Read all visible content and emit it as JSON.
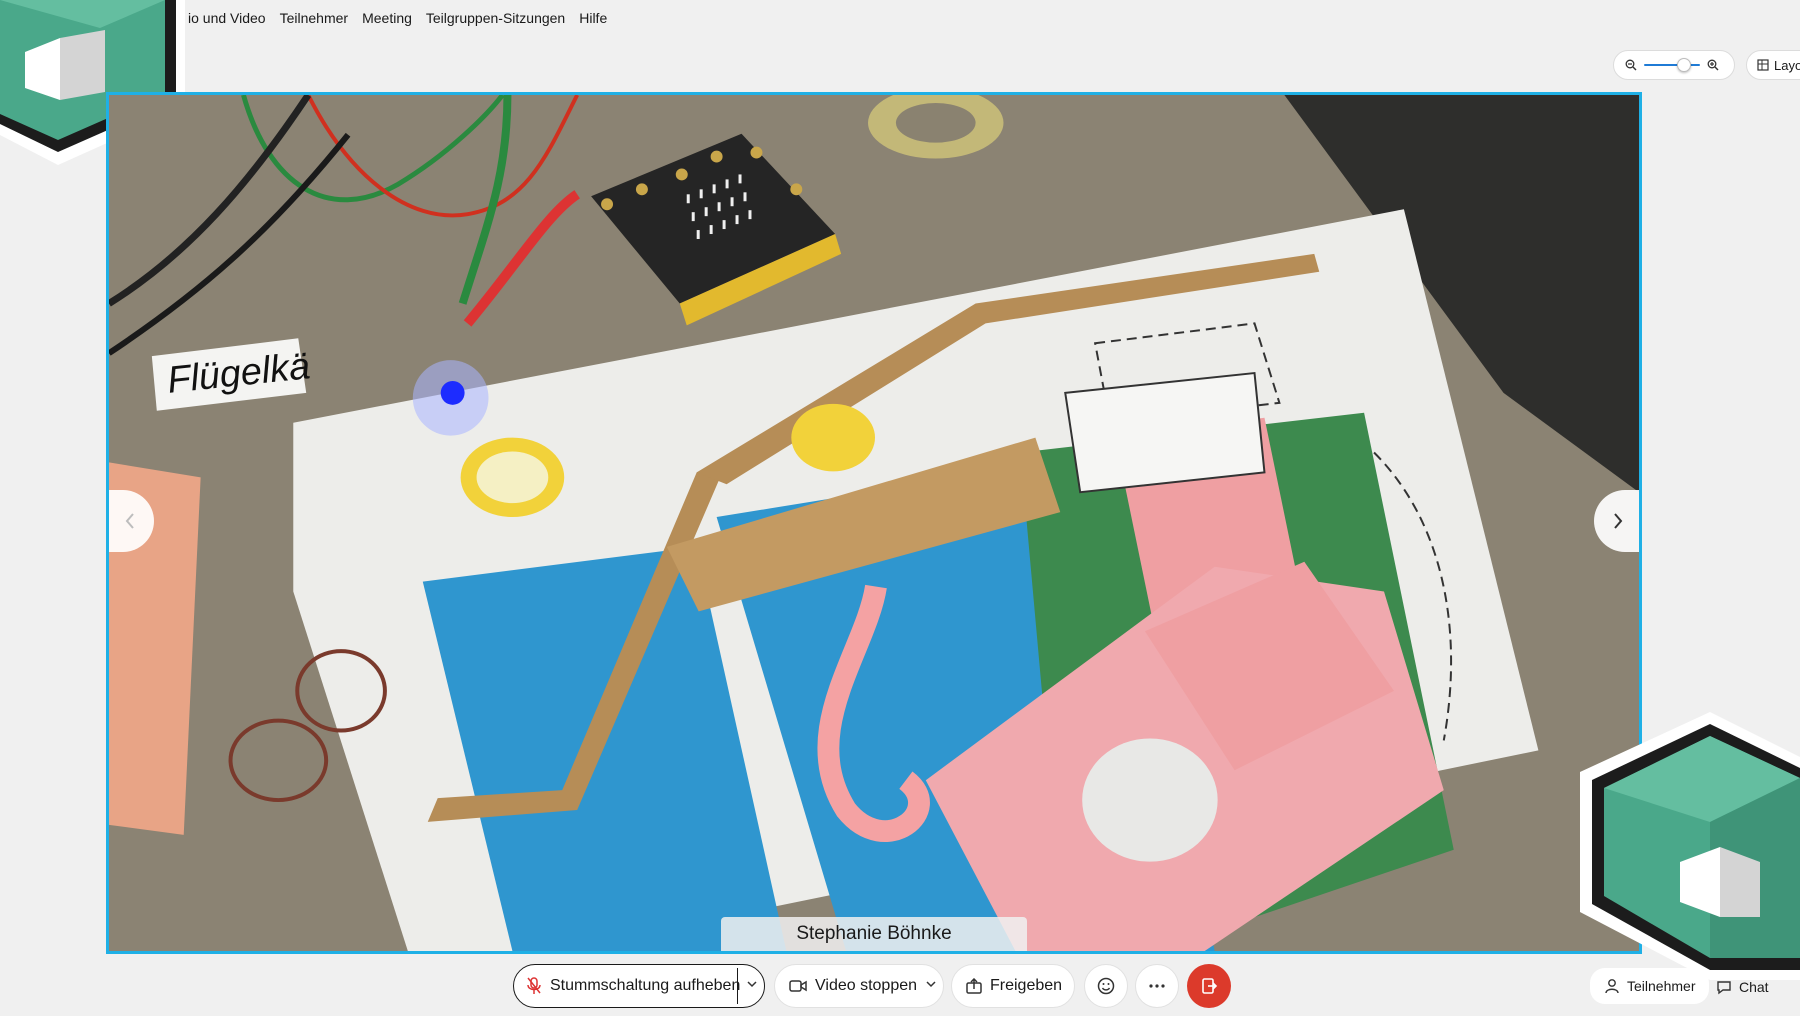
{
  "menu": {
    "items": [
      "io und Video",
      "Teilnehmer",
      "Meeting",
      "Teilgruppen-Sitzungen",
      "Hilfe"
    ]
  },
  "zoom": {
    "level_fraction": 0.78
  },
  "layout_button": {
    "label": "Layo"
  },
  "video": {
    "participant_name": "Stephanie Böhnke",
    "scene_text": "Flügelkä"
  },
  "controls": {
    "mute_label": "Stummschaltung aufheben",
    "video_label": "Video stoppen",
    "share_label": "Freigeben",
    "participants_label": "Teilnehmer",
    "chat_label": "Chat"
  },
  "colors": {
    "active_border": "#1fb0e6",
    "leave_red": "#dc3a2b",
    "hex_green": "#4aa88a",
    "accent_blue": "#1f7bd6"
  },
  "icons": {
    "mic": "microphone-off-icon",
    "camera": "video-camera-icon",
    "share": "share-icon",
    "reactions": "smiley-icon",
    "more": "more-dots-icon",
    "leave": "leave-door-icon",
    "participants": "person-icon",
    "chat": "chat-bubble-icon"
  }
}
